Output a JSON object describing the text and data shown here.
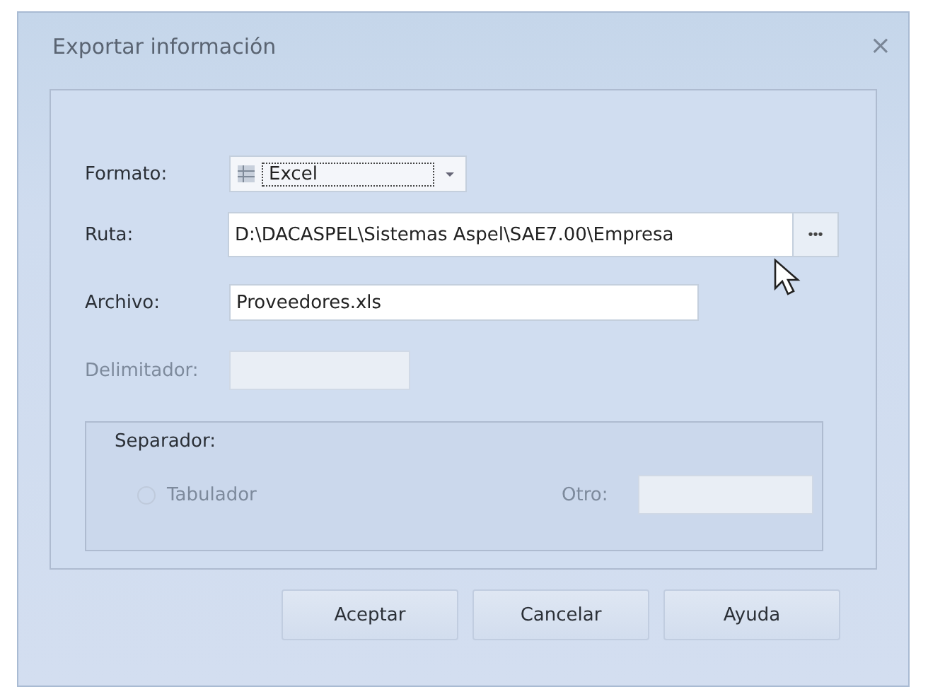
{
  "window": {
    "title": "Exportar información",
    "close": "×"
  },
  "fields": [
    {
      "kind": "combo",
      "label": "Formato:",
      "value": "Excel",
      "disabled": false
    },
    {
      "kind": "path",
      "label": "Ruta:",
      "value": "D:\\DACASPEL\\Sistemas Aspel\\SAE7.00\\Empresa",
      "button": "•••",
      "disabled": false
    },
    {
      "kind": "text",
      "label": "Archivo:",
      "value": "Proveedores.xls",
      "disabled": false
    },
    {
      "kind": "short",
      "label": "Delimitador:",
      "disabled": true
    }
  ],
  "separator": {
    "title": "Separador:",
    "radio": {
      "label": "Tabulador",
      "selected": false,
      "disabled": true
    },
    "other": {
      "label": "Otro:",
      "disabled": true
    }
  },
  "buttons": [
    "Aceptar",
    "Cancelar",
    "Ayuda"
  ]
}
